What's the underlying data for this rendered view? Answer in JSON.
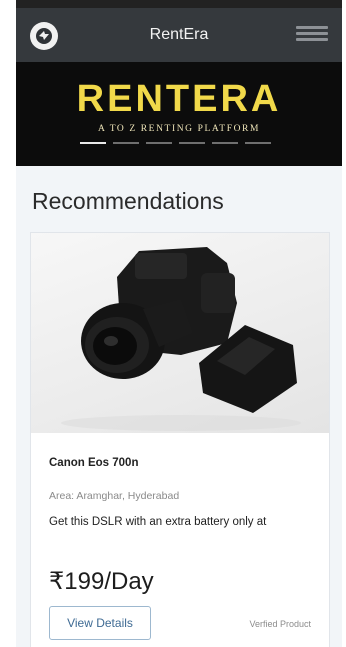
{
  "navbar": {
    "brand": "RentEra",
    "logo_icon": "brand-logo-icon",
    "menu_icon": "hamburger-menu-icon"
  },
  "banner": {
    "title": "RENTERA",
    "subtitle": "A TO Z RENTING PLATFORM",
    "slide_count": 6,
    "active_slide": 1
  },
  "section": {
    "title": "Recommendations"
  },
  "product": {
    "image_icon": "camera-photo",
    "name": "Canon Eos 700n",
    "area": "Area: Aramghar, Hyderabad",
    "description": "Get this DSLR with an extra battery only at",
    "price": "₹199/Day",
    "details_button": "View Details",
    "verified_label": "Verfied Product"
  },
  "colors": {
    "navbar": "#35393d",
    "banner_title": "#f1d94a",
    "accent": "#3e6a93"
  }
}
